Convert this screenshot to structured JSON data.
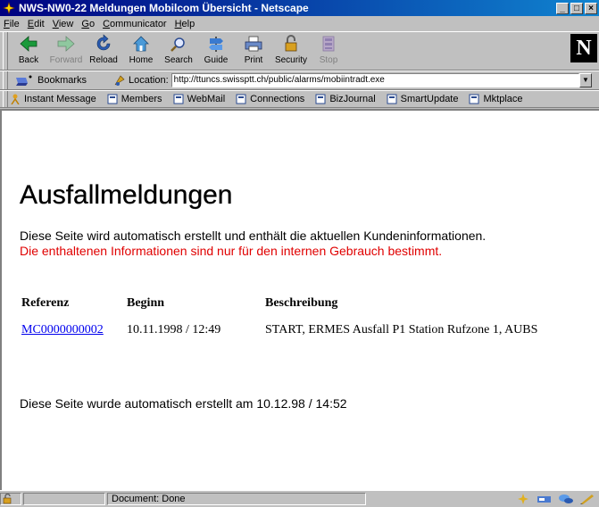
{
  "window": {
    "title": "NWS-NW0-22 Meldungen Mobilcom Übersicht - Netscape",
    "buttons": {
      "minimize": "_",
      "maximize": "□",
      "close": "×"
    }
  },
  "menubar": {
    "items": [
      {
        "pre": "",
        "key": "F",
        "post": "ile"
      },
      {
        "pre": "",
        "key": "E",
        "post": "dit"
      },
      {
        "pre": "",
        "key": "V",
        "post": "iew"
      },
      {
        "pre": "",
        "key": "G",
        "post": "o"
      },
      {
        "pre": "",
        "key": "C",
        "post": "ommunicator"
      },
      {
        "pre": "",
        "key": "H",
        "post": "elp"
      }
    ]
  },
  "toolbar": {
    "back": "Back",
    "forward": "Forward",
    "reload": "Reload",
    "home": "Home",
    "search": "Search",
    "guide": "Guide",
    "print": "Print",
    "security": "Security",
    "stop": "Stop",
    "logo": "N"
  },
  "location": {
    "bookmarks_label": "Bookmarks",
    "location_label": "Location:",
    "url": "http://ttuncs.swissptt.ch/public/alarms/mobiintradt.exe"
  },
  "personal": {
    "instant_message": "Instant Message",
    "members": "Members",
    "webmail": "WebMail",
    "connections": "Connections",
    "bizjournal": "BizJournal",
    "smartupdate": "SmartUpdate",
    "mktplace": "Mktplace"
  },
  "page": {
    "heading": "Ausfallmeldungen",
    "intro": "Diese Seite wird automatisch erstellt und enthält die aktuellen Kundeninformationen.",
    "notice": "Die enthaltenen Informationen sind nur für den internen Gebrauch bestimmt.",
    "table": {
      "headers": {
        "ref": "Referenz",
        "begin": "Beginn",
        "desc": "Beschreibung"
      },
      "rows": [
        {
          "ref": "MC0000000002",
          "begin": "10.11.1998 / 12:49",
          "desc": "START, ERMES Ausfall P1 Station Rufzone 1, AUBS"
        }
      ]
    },
    "generated": "Diese Seite wurde automatisch erstellt am 10.12.98 / 14:52"
  },
  "status": {
    "text": "Document: Done"
  },
  "colors": {
    "title_bar": "#000080",
    "link": "#0000ee",
    "notice": "#e00000"
  }
}
